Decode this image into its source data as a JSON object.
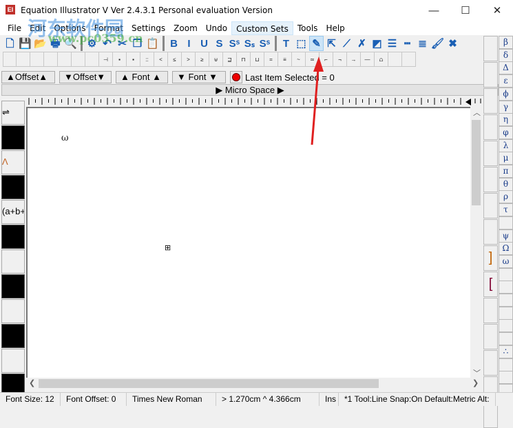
{
  "window": {
    "title": "Equation Illustrator V  Ver 2.4.3.1 Personal evaluation Version",
    "minimize": "—",
    "maximize": "☐",
    "close": "✕"
  },
  "watermark": {
    "text": "河东软件园",
    "url_text": "www.pc0359.cn"
  },
  "menu": [
    "File",
    "Edit",
    "Options",
    "Format",
    "Settings",
    "Zoom",
    "Undo",
    "Custom Sets",
    "Tools",
    "Help"
  ],
  "toolbar1": [
    {
      "name": "new-icon",
      "glyph": "🗋"
    },
    {
      "name": "save-icon",
      "glyph": "💾"
    },
    {
      "name": "open-icon",
      "glyph": "📂"
    },
    {
      "name": "print-icon",
      "glyph": "🖶"
    },
    {
      "name": "preview-icon",
      "glyph": "🔍"
    },
    {
      "sep": true
    },
    {
      "name": "settings-page-icon",
      "glyph": "⚙"
    },
    {
      "name": "undo-icon",
      "glyph": "↶"
    },
    {
      "name": "cut-icon",
      "glyph": "✂"
    },
    {
      "name": "copy-icon",
      "glyph": "❐"
    },
    {
      "name": "paste-icon",
      "glyph": "📋"
    },
    {
      "sep": true
    },
    {
      "name": "bold-icon",
      "glyph": "B"
    },
    {
      "name": "italic-icon",
      "glyph": "I"
    },
    {
      "name": "underline-icon",
      "glyph": "U"
    },
    {
      "name": "strike-icon",
      "glyph": "S"
    },
    {
      "name": "superscript-icon",
      "glyph": "Sˢ"
    },
    {
      "name": "subscript-icon",
      "glyph": "Sₛ"
    },
    {
      "name": "super-small-icon",
      "glyph": "Sˢ"
    },
    {
      "sep": true
    },
    {
      "name": "text-tool-icon",
      "glyph": "T"
    },
    {
      "name": "select-tool-icon",
      "glyph": "⬚"
    },
    {
      "name": "pencil-line-tool-icon",
      "glyph": "✎",
      "active": true
    },
    {
      "name": "move-tool-icon",
      "glyph": "⇱"
    },
    {
      "name": "node-line-icon",
      "glyph": "⟋"
    },
    {
      "name": "erase-pencil-icon",
      "glyph": "✗"
    },
    {
      "name": "shapes-icon",
      "glyph": "◩"
    },
    {
      "name": "thick-lines-icon",
      "glyph": "☰"
    },
    {
      "name": "dashed-lines-icon",
      "glyph": "┅"
    },
    {
      "name": "color-lines-icon",
      "glyph": "≣"
    },
    {
      "name": "brush-icon",
      "glyph": "🖌"
    },
    {
      "name": "color-cross-icon",
      "glyph": "✖"
    }
  ],
  "toolbar2": [
    "",
    "",
    "",
    "",
    "",
    "",
    "",
    "⊣",
    "▪",
    "▪",
    "::",
    "<",
    "≤",
    ">",
    "≥",
    "⊎",
    "⊒",
    "⊓",
    "⊔",
    "=",
    "≡",
    "~",
    "≃",
    "⌐",
    "¬",
    "→",
    "—",
    "⩍",
    "",
    ""
  ],
  "controls": {
    "offset_up": "▲Offset▲",
    "offset_down": "▼Offset▼",
    "font_up": "▲ Font ▲",
    "font_down": "▼ Font ▼",
    "last_item": "Last Item Selected = 0",
    "micro_space": "▶ Micro Space ▶"
  },
  "left_panel": [
    "⇌",
    "",
    "Λ",
    "",
    "(a+b+",
    "",
    "",
    "",
    "",
    "",
    "",
    ""
  ],
  "canvas": {
    "symbol": "ω",
    "cursor_marker": "⊞"
  },
  "right_col2": [
    "",
    "",
    "",
    "",
    "",
    "",
    "",
    "",
    "",
    "",
    "",
    "",
    "",
    "",
    ""
  ],
  "right_col2_brackets": {
    "close": "]",
    "open": "["
  },
  "greek": [
    "β",
    "δ",
    "Δ",
    "ε",
    "ϕ",
    "γ",
    "η",
    "φ",
    "λ",
    "μ",
    "π",
    "θ",
    "ρ",
    "τ",
    "",
    "ψ",
    "Ω",
    "ω",
    "",
    "",
    "",
    "",
    "",
    "",
    "∴",
    "",
    "",
    ""
  ],
  "status": [
    "Font Size: 12",
    "Font Offset: 0",
    "Times New Roman",
    "> 1.270cm   ^ 4.366cm",
    "Ins",
    "*1 Tool:Line  Snap:On  Default:Metric  Alt:"
  ],
  "colors": {
    "accent": "#1a5fb4",
    "annotation_arrow": "#e02020",
    "active_tool": "#cce4f7"
  }
}
